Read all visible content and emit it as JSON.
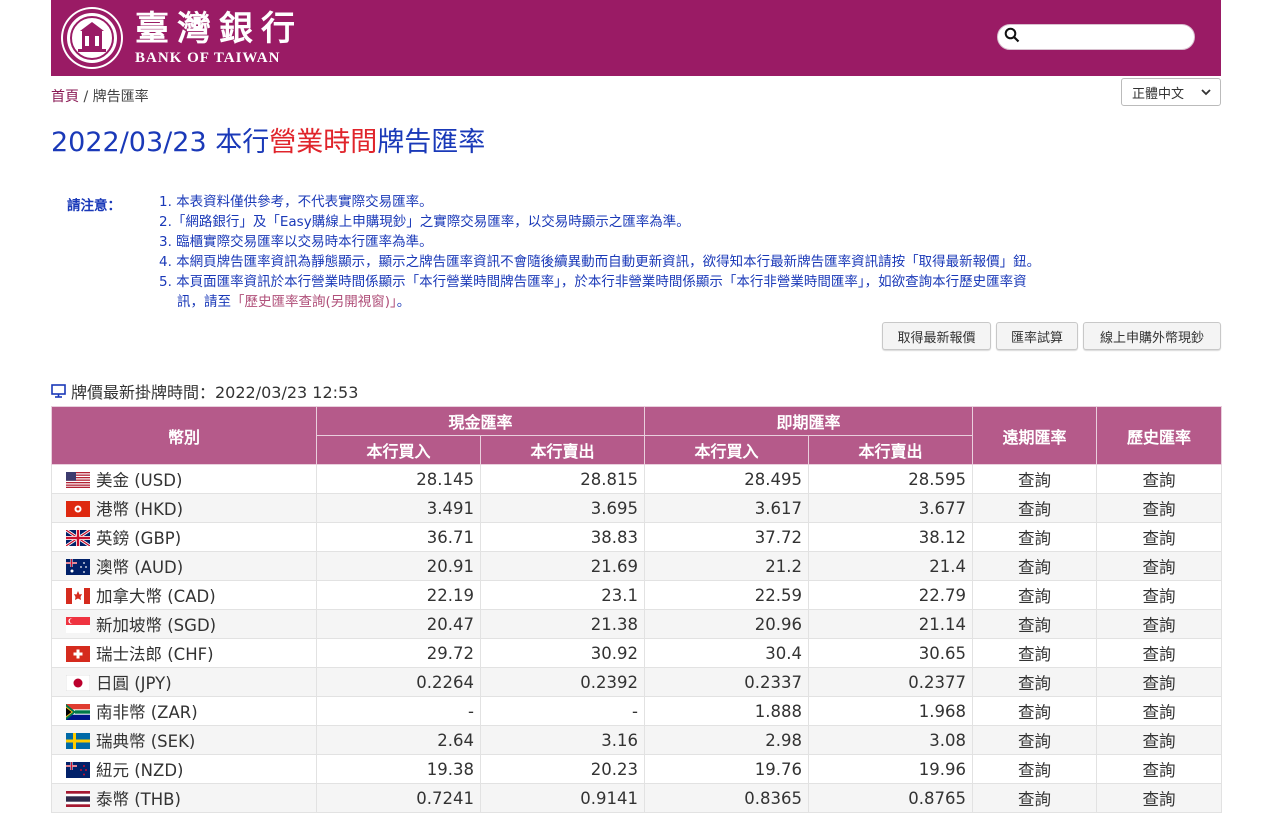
{
  "header": {
    "logo_cn": "臺灣銀行",
    "logo_en": "BANK OF TAIWAN",
    "brand_color": "#9a1b65",
    "search_placeholder": ""
  },
  "breadcrumb": {
    "home": "首頁",
    "sep": "/",
    "current": "牌告匯率"
  },
  "language_select": {
    "selected": "正體中文"
  },
  "title": {
    "prefix": "2022/03/23 本行",
    "highlight": "營業時間",
    "suffix": "牌告匯率"
  },
  "notes": {
    "label": "請注意：",
    "items": [
      "1. 本表資料僅供參考，不代表實際交易匯率。",
      "2.「網路銀行」及「Easy購線上申購現鈔」之實際交易匯率，以交易時顯示之匯率為準。",
      "3. 臨櫃實際交易匯率以交易時本行匯率為準。",
      "4. 本網頁牌告匯率資訊為靜態顯示，顯示之牌告匯率資訊不會隨後續異動而自動更新資訊，欲得知本行最新牌告匯率資訊請按「取得最新報價」鈕。",
      "5. 本頁面匯率資訊於本行營業時間係顯示「本行營業時間牌告匯率」，於本行非營業時間係顯示「本行非營業時間匯率」，如欲查詢本行歷史匯率資"
    ],
    "item5_cont_prefix": "訊，請至",
    "item5_link": "「歷史匯率查詢(另開視窗)」",
    "item5_cont_suffix": "。"
  },
  "buttons": {
    "refresh": "取得最新報價",
    "calculator": "匯率試算",
    "buy_cash": "線上申購外幣現鈔"
  },
  "updated": {
    "label": "牌價最新掛牌時間：2022/03/23 12:53"
  },
  "table": {
    "headers": {
      "currency": "幣別",
      "cash": "現金匯率",
      "spot": "即期匯率",
      "forward": "遠期匯率",
      "history": "歷史匯率",
      "buy": "本行買入",
      "sell": "本行賣出"
    },
    "link_text": "查詢",
    "rows": [
      {
        "flag": "us",
        "name": "美金 (USD)",
        "cash_buy": "28.145",
        "cash_sell": "28.815",
        "spot_buy": "28.495",
        "spot_sell": "28.595"
      },
      {
        "flag": "hk",
        "name": "港幣 (HKD)",
        "cash_buy": "3.491",
        "cash_sell": "3.695",
        "spot_buy": "3.617",
        "spot_sell": "3.677"
      },
      {
        "flag": "gb",
        "name": "英鎊 (GBP)",
        "cash_buy": "36.71",
        "cash_sell": "38.83",
        "spot_buy": "37.72",
        "spot_sell": "38.12"
      },
      {
        "flag": "au",
        "name": "澳幣 (AUD)",
        "cash_buy": "20.91",
        "cash_sell": "21.69",
        "spot_buy": "21.2",
        "spot_sell": "21.4"
      },
      {
        "flag": "ca",
        "name": "加拿大幣 (CAD)",
        "cash_buy": "22.19",
        "cash_sell": "23.1",
        "spot_buy": "22.59",
        "spot_sell": "22.79"
      },
      {
        "flag": "sg",
        "name": "新加坡幣 (SGD)",
        "cash_buy": "20.47",
        "cash_sell": "21.38",
        "spot_buy": "20.96",
        "spot_sell": "21.14"
      },
      {
        "flag": "ch",
        "name": "瑞士法郎 (CHF)",
        "cash_buy": "29.72",
        "cash_sell": "30.92",
        "spot_buy": "30.4",
        "spot_sell": "30.65"
      },
      {
        "flag": "jp",
        "name": "日圓 (JPY)",
        "cash_buy": "0.2264",
        "cash_sell": "0.2392",
        "spot_buy": "0.2337",
        "spot_sell": "0.2377"
      },
      {
        "flag": "za",
        "name": "南非幣 (ZAR)",
        "cash_buy": "-",
        "cash_sell": "-",
        "spot_buy": "1.888",
        "spot_sell": "1.968"
      },
      {
        "flag": "se",
        "name": "瑞典幣 (SEK)",
        "cash_buy": "2.64",
        "cash_sell": "3.16",
        "spot_buy": "2.98",
        "spot_sell": "3.08"
      },
      {
        "flag": "nz",
        "name": "紐元 (NZD)",
        "cash_buy": "19.38",
        "cash_sell": "20.23",
        "spot_buy": "19.76",
        "spot_sell": "19.96"
      },
      {
        "flag": "th",
        "name": "泰幣 (THB)",
        "cash_buy": "0.7241",
        "cash_sell": "0.9141",
        "spot_buy": "0.8365",
        "spot_sell": "0.8765"
      }
    ]
  }
}
